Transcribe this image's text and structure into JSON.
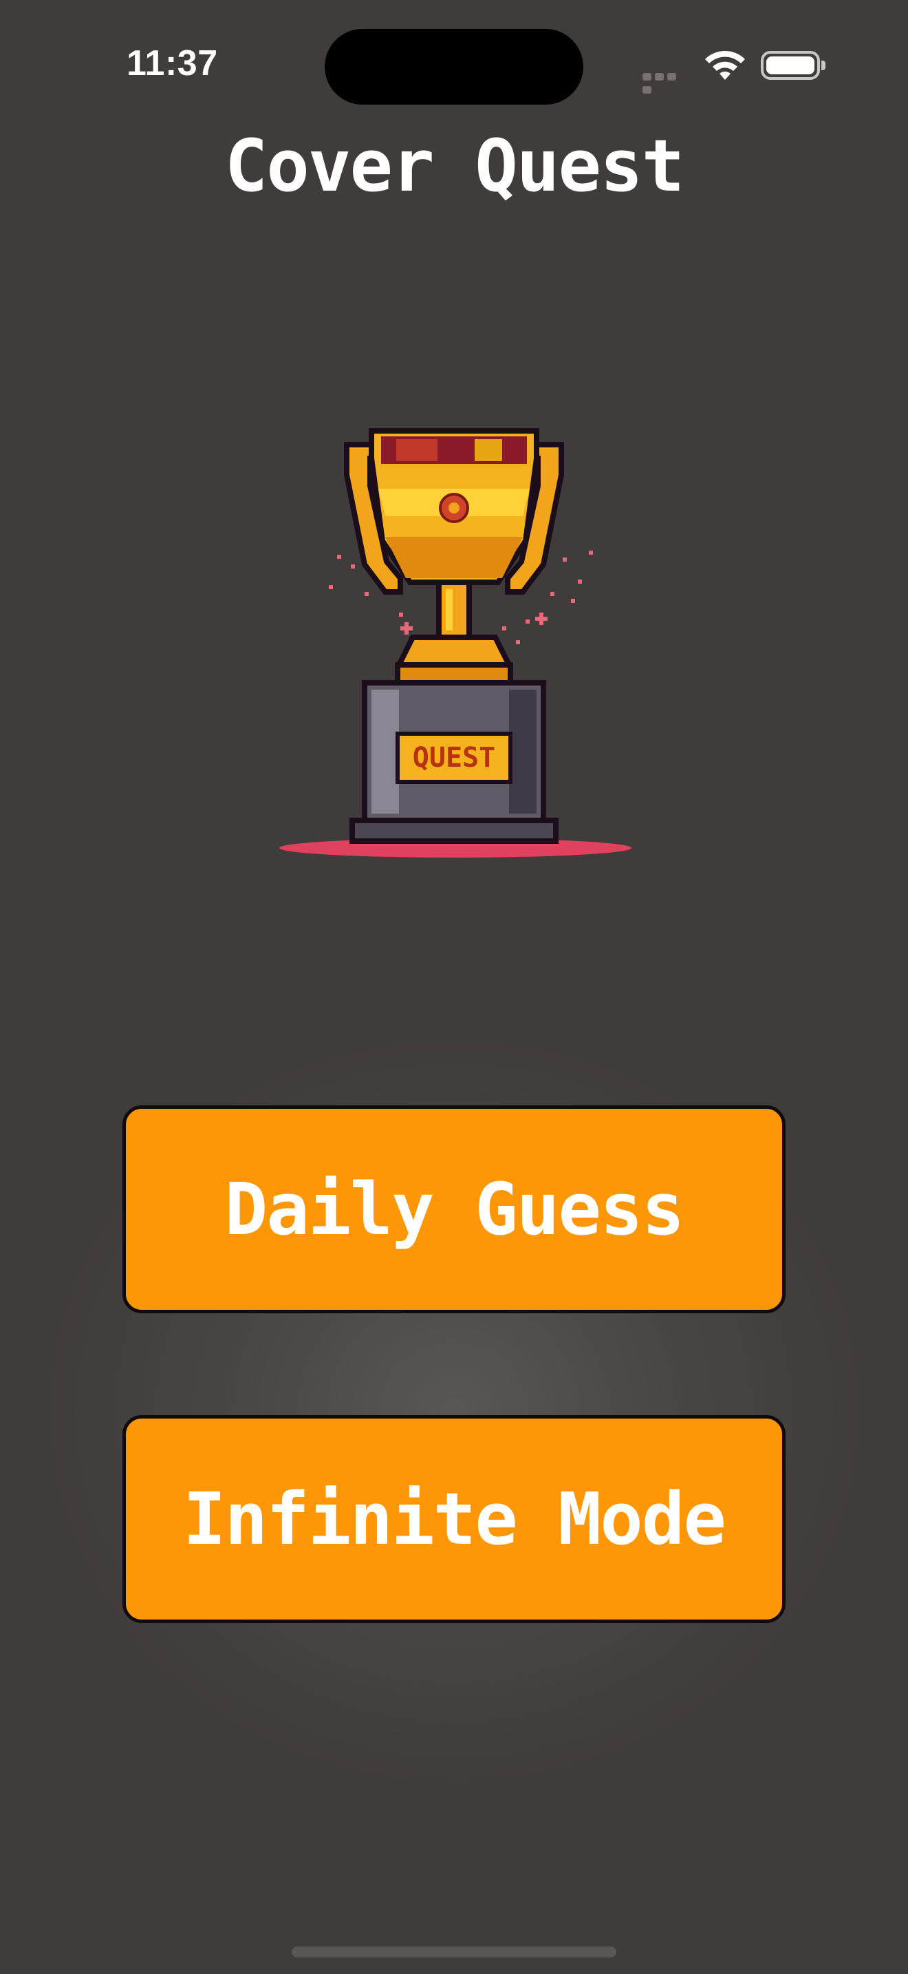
{
  "status_bar": {
    "time": "11:37",
    "icons": [
      "signal-icon",
      "wifi-icon",
      "battery-icon"
    ]
  },
  "header": {
    "title": "Cover Quest"
  },
  "hero": {
    "image": "trophy-icon",
    "plaque_text": "QUEST"
  },
  "menu": {
    "daily_label": "Daily Guess",
    "infinite_label": "Infinite Mode"
  },
  "colors": {
    "background": "#413c3c",
    "button": "#fe9707",
    "button_border": "#0d0b0b",
    "text": "#ffffff"
  }
}
